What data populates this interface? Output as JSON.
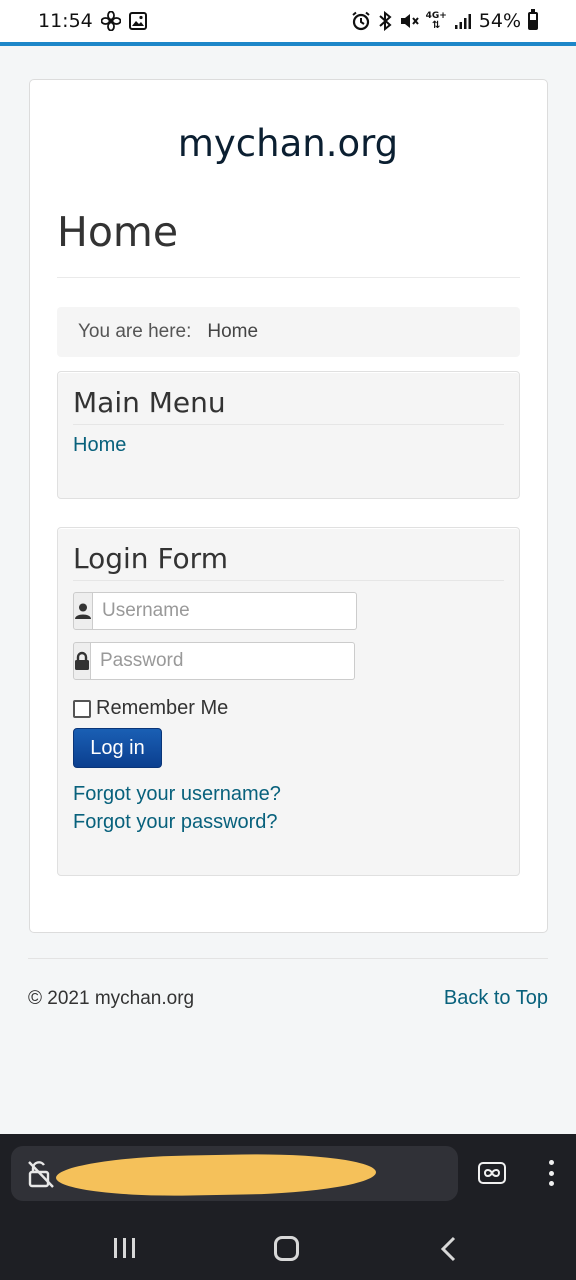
{
  "status_bar": {
    "time": "11:54",
    "battery": "54%",
    "left_icons": [
      "fan-icon",
      "image-icon"
    ],
    "right_icons": [
      "alarm-icon",
      "bluetooth-icon",
      "mute-icon",
      "4g-plus-icon",
      "signal-icon",
      "battery-icon"
    ],
    "network": "4G+",
    "accent_color": "#1d87c9"
  },
  "site": {
    "title": "mychan.org"
  },
  "page": {
    "heading": "Home"
  },
  "breadcrumb": {
    "prefix": "You are here:",
    "current": "Home"
  },
  "main_menu": {
    "title": "Main Menu",
    "items": [
      {
        "label": "Home"
      }
    ]
  },
  "login_form": {
    "title": "Login Form",
    "username_placeholder": "Username",
    "username_value": "",
    "password_placeholder": "Password",
    "password_value": "",
    "remember_label": "Remember Me",
    "remember_checked": false,
    "login_button": "Log in",
    "forgot_username": "Forgot your username?",
    "forgot_password": "Forgot your password?",
    "button_color": "#0b3f8f",
    "link_color": "#08617c"
  },
  "footer": {
    "copyright": "© 2021 mychan.org",
    "back_to_top": "Back to Top"
  },
  "browser": {
    "url_redacted": true,
    "icons": [
      "unlock-icon",
      "tabs-icon",
      "more-icon"
    ]
  },
  "nav_bar": {
    "icons": [
      "recent-apps-icon",
      "home-icon",
      "back-icon"
    ]
  }
}
